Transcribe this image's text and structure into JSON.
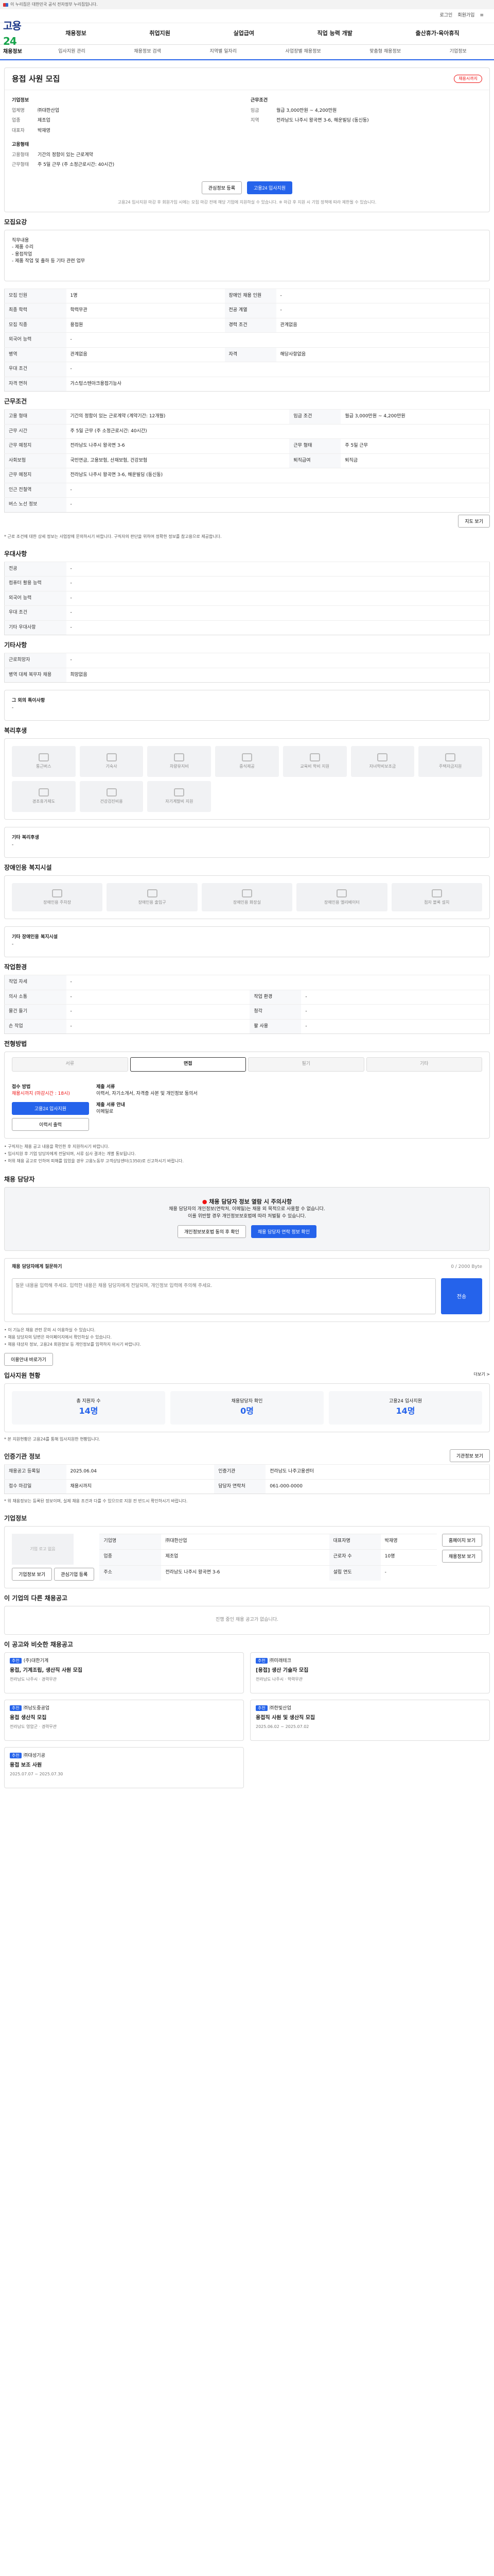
{
  "gov_banner": {
    "text": "이 누리집은 대한민국 공식 전자정부 누리집입니다."
  },
  "top_links": {
    "login": "로그인",
    "join": "회원가입",
    "more": "≡"
  },
  "header": {
    "logo_left": "고용",
    "logo_right": "24",
    "menu": [
      "채용정보",
      "취업지원",
      "실업급여",
      "직업 능력 개발",
      "출산휴가·육아휴직"
    ]
  },
  "subnav": {
    "current": "채용정보",
    "items": [
      "입사지원 관리",
      "채용정보 검색",
      "지역별 일자리",
      "사업장별 채용정보",
      "맞춤형 채용정보",
      "기업정보"
    ]
  },
  "job": {
    "title": "용접 사원 모집",
    "status": "채용시까지",
    "company_label": "기업정보",
    "company_rows": [
      {
        "k": "업체명",
        "v": "㈜대한산업"
      },
      {
        "k": "업종",
        "v": "제조업"
      },
      {
        "k": "대표자",
        "v": "박재영"
      }
    ],
    "cond_label": "근무조건",
    "cond_rows": [
      {
        "k": "임금",
        "v": "월급 3,000만원 ~ 4,200만원"
      },
      {
        "k": "지역",
        "v": "전라남도 나주시 왕곡면 3-6, 해운빌딩 (동신동)"
      }
    ],
    "emp_label": "고용형태",
    "emp_rows": [
      {
        "k": "고용형태",
        "v": "기간의 정함이 있는 근로계약"
      },
      {
        "k": "근무형태",
        "v": "주 5일 근무 (주 소정근로시간: 40시간)"
      }
    ],
    "buttons": {
      "scrap": "관심정보 등록",
      "apply": "고용24 입사지원"
    },
    "note": "고용24 입사지원 마감 후 회원가입 시에는 모집 마감 전에 해당 기업에 지원하실 수 있습니다. ※ 마감 후 지원 시 기업 정책에 따라 제한될 수 있습니다."
  },
  "recruit": {
    "section": "모집요강",
    "detail_title": "직무내용",
    "detail_lines": [
      "직무내용",
      "- 제품 수리",
      "- 용접작업",
      "- 제품 작업 및 출하 등 기타 관련 업무"
    ],
    "rows": [
      {
        "k": "모집 인원",
        "v": "1명",
        "k2": "장애인 채용 인원",
        "v2": "-"
      },
      {
        "k": "최종 학력",
        "v": "학력무관",
        "k2": "전공 계열",
        "v2": "-"
      },
      {
        "k": "모집 직종",
        "v": "용접원",
        "k2": "경력 조건",
        "v2": "관계없음"
      },
      {
        "k": "외국어 능력",
        "v": "-",
        "k2": "",
        "v2": ""
      },
      {
        "k": "병역",
        "v": "관계없음",
        "k2": "자격",
        "v2": "해당사항없음"
      },
      {
        "k": "우대 조건",
        "v": "-",
        "k2": "",
        "v2": ""
      },
      {
        "k": "자격 면허",
        "v": "가스텅스텐아크용접기능사",
        "k2": "",
        "v2": ""
      }
    ]
  },
  "work": {
    "section": "근무조건",
    "rows": [
      {
        "k": "고용 형태",
        "v": "기간의 정함이 있는 근로계약 (계약기간: 12개월)",
        "k2": "임금 조건",
        "v2": "월급 3,000만원 ~ 4,200만원"
      },
      {
        "k": "근무 시간",
        "v": "주 5일 근무 (주 소정근로시간: 40시간)",
        "k2": "",
        "v2": ""
      },
      {
        "k": "근무 예정지",
        "v": "전라남도 나주시 왕곡면 3-6",
        "k2": "근무 형태",
        "v2": "주 5일 근무"
      },
      {
        "k": "사회보험",
        "v": "국민연금, 고용보험, 산재보험, 건강보험",
        "k2": "퇴직급여",
        "v2": "퇴직금"
      },
      {
        "k": "근무 예정지",
        "v": "전라남도 나주시 왕곡면 3-6, 해운빌딩 (동신동)",
        "k2": "",
        "v2": ""
      },
      {
        "k": "인근 전철역",
        "v": "-",
        "k2": "",
        "v2": ""
      },
      {
        "k": "버스 노선 정보",
        "v": "-",
        "k2": "",
        "v2": ""
      }
    ],
    "map_button": "지도 보기",
    "note": "* 근로 조건에 대한 상세 정보는 사업장에 문의하시기 바랍니다. 구직자의 판단을 위하여 정확한 정보를 참고용으로 제공합니다."
  },
  "prefer": {
    "section": "우대사항",
    "rows": [
      {
        "k": "전공",
        "v": "-"
      },
      {
        "k": "컴퓨터 활용 능력",
        "v": "-"
      },
      {
        "k": "외국어 능력",
        "v": "-"
      },
      {
        "k": "우대 조건",
        "v": "-"
      },
      {
        "k": "기타 우대사항",
        "v": "-"
      }
    ]
  },
  "etc": {
    "section": "기타사항",
    "rows": [
      {
        "k": "근로희망자",
        "v": "-"
      },
      {
        "k": "병역 대체 복무자 채용",
        "v": "희망없음"
      }
    ],
    "box_title": "그 외의 특이사항",
    "box_value": "-"
  },
  "welfare": {
    "section": "복리후생",
    "items": [
      "통근버스",
      "기숙사",
      "차량유지비",
      "중식제공",
      "교육비 학비 지원",
      "자녀학비보조금",
      "주택자금지원",
      "경조휴가제도",
      "건강검진비용",
      "자기계발비 지원"
    ],
    "box_title": "기타 복리후생",
    "box_value": "-"
  },
  "disability": {
    "section": "장애인용 복지시설",
    "items": [
      "장애인용 주차장",
      "장애인용 출입구",
      "장애인용 화장실",
      "장애인용 엘리베이터",
      "점자 블록 설치"
    ],
    "box_title": "기타 장애인용 복지시설",
    "box_value": "-"
  },
  "environment": {
    "section": "작업환경",
    "rows": [
      {
        "k": "작업 자세",
        "v": "-",
        "k2": "",
        "v2": ""
      },
      {
        "k": "의사 소통",
        "v": "-",
        "k2": "작업 환경",
        "v2": "-"
      },
      {
        "k": "물건 들기",
        "v": "-",
        "k2": "청각",
        "v2": "-"
      },
      {
        "k": "손 작업",
        "v": "-",
        "k2": "팔 사용",
        "v2": "-"
      }
    ]
  },
  "method": {
    "section": "전형방법",
    "tabs": [
      "서류",
      "면접",
      "필기",
      "기타"
    ],
    "active_tab": 1,
    "apply_left_title": "접수 방법",
    "apply_method": "채용시까지 (마감시간 : 18시)",
    "apply_btn": "고용24 입사지원",
    "print_btn": "이력서 출력",
    "apply_right_title": "제출 서류",
    "apply_docs": "이력서, 자기소개서, 자격증 사본 및 개인정보 동의서",
    "docs_sub_title": "제출 서류 안내",
    "docs_sub_value": "이메일로",
    "notes": [
      "• 구직자는 채용 공고 내용을 확인한 후 지원하시기 바랍니다.",
      "• 입사지원 후 기업 담당자에게 전달되며, 서류 심사 결과는 개별 통보됩니다.",
      "• 허위 채용 공고로 인하여 피해를 입었을 경우 고용노동부 고객상담센터(1350)로 신고하시기 바랍니다."
    ]
  },
  "manager": {
    "section": "채용 담당자",
    "alert": "채용 담당자 정보 열람 시 주의사항",
    "line1": "채용 담당자의 개인정보(연락처, 이메일)는 채용 외 목적으로 사용할 수 없습니다.",
    "line2": "이를 위반할 경우 개인정보보호법에 따라 처벌될 수 있습니다.",
    "btn_agree": "개인정보보호법 동의 후 확인",
    "btn_view": "채용 담당자 연락 정보 확인"
  },
  "question": {
    "section": "채용 담당자에게 질문하기",
    "counter": "0 / 2000 Byte",
    "placeholder": "질문 내용을 입력해 주세요. 입력한 내용은 채용 담당자에게 전달되며, 개인정보 입력에 주의해 주세요.",
    "submit": "전송",
    "notes": [
      "• 이 기능은 채용 관련 문의 시 이용하실 수 있습니다.",
      "• 채용 담당자의 답변은 마이페이지에서 확인하실 수 있습니다.",
      "• 채용 대상자 정보, 고용24 회원정보 등 개인정보를 입력하지 마시기 바랍니다."
    ],
    "more": "이용안내 바로가기"
  },
  "status": {
    "section": "입사지원 현황",
    "more": "더보기 >",
    "items": [
      {
        "label": "총 지원자 수",
        "value": "14명"
      },
      {
        "label": "채용담당자 확인",
        "value": "0명"
      },
      {
        "label": "고용24 입사지원",
        "value": "14명"
      }
    ],
    "note": "* 본 지원현황은 고용24를 통해 입사지원한 현황입니다."
  },
  "reg": {
    "section": "인증기관 정보",
    "btn": "기관정보 보기",
    "rows": [
      {
        "k": "채용공고 등록일",
        "v": "2025.06.04",
        "k2": "인증기관",
        "v2": "전라남도 나주고용센터"
      },
      {
        "k": "접수 마감일",
        "v": "채용시까지",
        "k2": "담당자 연락처",
        "v2": "061-000-0000"
      }
    ],
    "note": "* 위 채용정보는 등록된 정보이며, 실제 채용 조건과 다를 수 있으므로 지원 전 반드시 확인하시기 바랍니다."
  },
  "company": {
    "section": "기업정보",
    "logo": "기업 로고 없음",
    "rows": [
      {
        "k": "기업명",
        "v": "㈜대한산업",
        "k2": "대표자명",
        "v2": "박재영"
      },
      {
        "k": "업종",
        "v": "제조업",
        "k2": "근로자 수",
        "v2": "10명"
      },
      {
        "k": "주소",
        "v": "전라남도 나주시 왕곡면 3-6",
        "k2": "설립 연도",
        "v2": "-"
      }
    ],
    "btn_more": "기업정보 보기",
    "btn_follow": "관심기업 등록",
    "btn_home": "홈페이지 보기",
    "btn_list": "채용정보 보기"
  },
  "similar": {
    "section": "이 기업의 다른 채용공고",
    "empty": "진행 중인 채용 공고가 없습니다."
  },
  "recommend": {
    "section": "이 공고와 비슷한 채용공고",
    "items": [
      {
        "badge": "추천",
        "company": "(주)대한기계",
        "title": "용접, 기계조립, 생산직 사원 모집",
        "meta": "전라남도 나주시 · 경력무관"
      },
      {
        "badge": "추천",
        "company": "㈜미래테크",
        "title": "[용접] 생산 기술자 모집",
        "meta": "전라남도 나주시 · 학력무관"
      },
      {
        "badge": "추천",
        "company": "㈜남도중공업",
        "title": "용접 생산직 모집",
        "meta": "전라남도 영암군 · 경력무관"
      },
      {
        "badge": "추천",
        "company": "㈜한빛산업",
        "title": "용접직 사원 및 생산직 모집",
        "meta": "2025.06.02 ~ 2025.07.02"
      },
      {
        "badge": "추천",
        "company": "㈜대성기공",
        "title": "용접 보조 사원",
        "meta": "2025.07.07 ~ 2025.07.30"
      }
    ]
  }
}
